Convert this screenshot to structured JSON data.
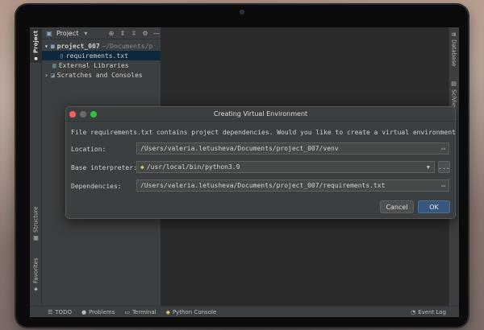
{
  "left_tabs": {
    "project": "Project",
    "structure": "Structure",
    "favorites": "Favorites"
  },
  "right_tabs": {
    "database": "Database",
    "sciview": "SciView"
  },
  "project_panel": {
    "header_label": "Project",
    "tree": [
      {
        "name": "project_007",
        "path": "~/Documents/p"
      },
      {
        "name": "requirements.txt"
      },
      {
        "name": "External Libraries"
      },
      {
        "name": "Scratches and Consoles"
      }
    ]
  },
  "dialog": {
    "title": "Creating Virtual Environment",
    "message": "File requirements.txt contains project dependencies. Would you like to create a virtual environment using it?",
    "location_label": "Location:",
    "location_value": "/Users/valeria.letusheva/Documents/project_007/venv",
    "interpreter_label": "Base interpreter:",
    "interpreter_value": "/usr/local/bin/python3.9",
    "dependencies_label": "Dependencies:",
    "dependencies_value": "/Users/valeria.letusheva/Documents/project_007/requirements.txt",
    "browse_label": "...",
    "cancel_label": "Cancel",
    "ok_label": "OK"
  },
  "bottom_bar": {
    "todo": "TODO",
    "problems": "Problems",
    "terminal": "Terminal",
    "python_console": "Python Console",
    "event_log": "Event Log"
  },
  "colors": {
    "traffic_red": "#ff5f57",
    "traffic_yellow": "#febc2e",
    "traffic_green": "#28c840",
    "ok_button": "#365880",
    "selection": "#0d293e"
  }
}
